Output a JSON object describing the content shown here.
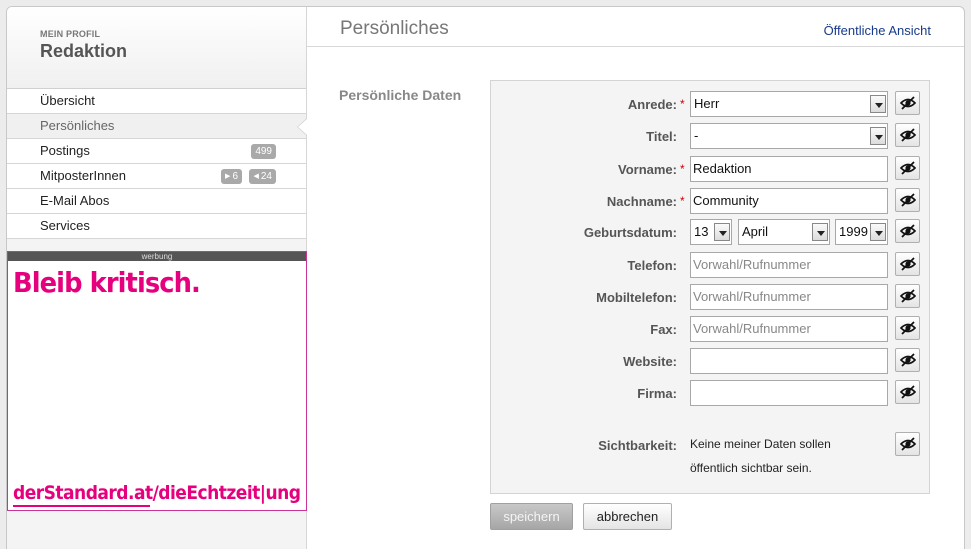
{
  "sidebar": {
    "kicker": "MEIN PROFIL",
    "name": "Redaktion",
    "nav": [
      {
        "label": "Übersicht"
      },
      {
        "label": "Persönliches"
      },
      {
        "label": "Postings",
        "badge": "499"
      },
      {
        "label": "MitposterInnen",
        "badge_in": "6",
        "badge_out": "24"
      },
      {
        "label": "E-Mail Abos"
      },
      {
        "label": "Services"
      }
    ]
  },
  "ad": {
    "label": "werbung",
    "headline": "Bleib kritisch.",
    "footer": "derStandard.at/dieEchtzeit|ung",
    "color": "#e6007e"
  },
  "header": {
    "title": "Persönliches",
    "public_view": "Öffentliche Ansicht"
  },
  "form": {
    "section_label": "Persönliche Daten",
    "anrede": {
      "label": "Anrede:",
      "value": "Herr"
    },
    "titel": {
      "label": "Titel:",
      "value": "-"
    },
    "vorname": {
      "label": "Vorname:",
      "value": "Redaktion"
    },
    "nachname": {
      "label": "Nachname:",
      "value": "Community"
    },
    "geburtsdatum": {
      "label": "Geburtsdatum:",
      "day": "13",
      "month": "April",
      "year": "1999"
    },
    "telefon": {
      "label": "Telefon:",
      "placeholder": "Vorwahl/Rufnummer"
    },
    "mobiltelefon": {
      "label": "Mobiltelefon:",
      "placeholder": "Vorwahl/Rufnummer"
    },
    "fax": {
      "label": "Fax:",
      "placeholder": "Vorwahl/Rufnummer"
    },
    "website": {
      "label": "Website:",
      "value": ""
    },
    "firma": {
      "label": "Firma:",
      "value": ""
    },
    "sichtbarkeit": {
      "label": "Sichtbarkeit:",
      "line1": "Keine meiner Daten sollen",
      "line2": "öffentlich sichtbar sein."
    },
    "required_mark": "*"
  },
  "buttons": {
    "save": "speichern",
    "cancel": "abbrechen"
  },
  "icons": {
    "visibility": "eye-crossed-icon"
  }
}
